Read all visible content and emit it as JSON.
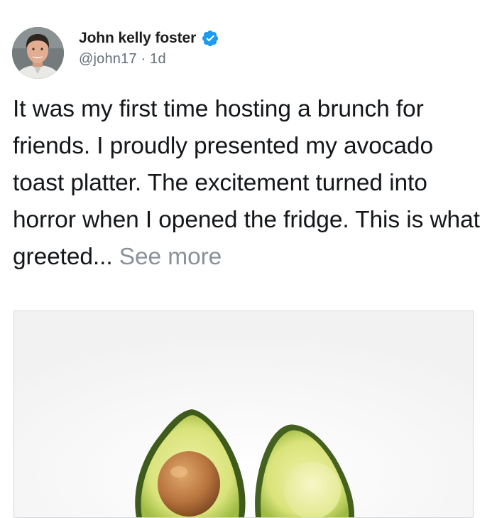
{
  "tweet": {
    "author": {
      "display_name": "John kelly foster",
      "verified_icon": "verified-badge-icon",
      "handle": "@john17",
      "separator": "·",
      "time_ago": "1d"
    },
    "text": "It was my first time hosting a brunch for friends. I proudly presented my avocado toast platter. The excitement turned into horror when I opened the fridge. This is what greeted...",
    "see_more_label": "See more",
    "media": {
      "subject": "two avocado halves, one with pit"
    }
  },
  "colors": {
    "text": "#14171a",
    "secondary_text": "#65717c",
    "see_more": "#8a9199",
    "verified_blue": "#1d9bf0",
    "media_border": "#d5d8dc"
  }
}
